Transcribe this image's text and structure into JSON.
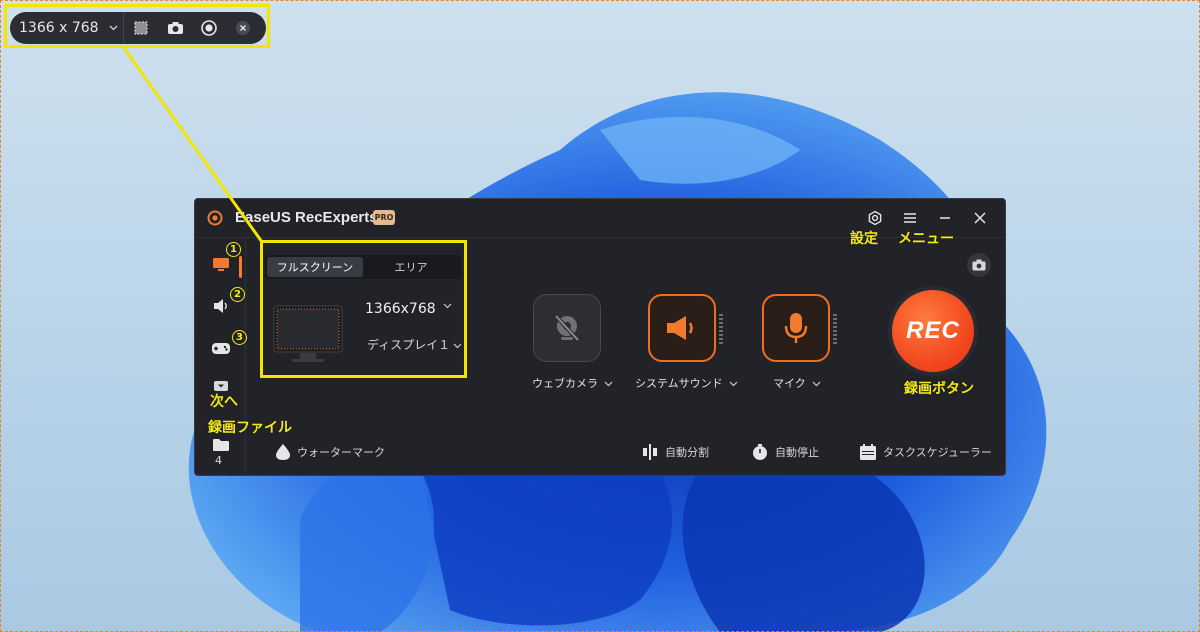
{
  "mini_toolbar": {
    "resolution": "1366 x 768",
    "icons": [
      "chevron-down-icon",
      "region-select-icon",
      "camera-icon",
      "record-icon",
      "close-icon"
    ]
  },
  "window": {
    "title": "EaseUS RecExperts",
    "badge": "PRO",
    "title_buttons": [
      "gear-icon",
      "menu-icon",
      "minimize-icon",
      "close-icon"
    ]
  },
  "sidebar": {
    "items": [
      "monitor-icon",
      "speaker-icon",
      "gamepad-icon",
      "chevron-down-icon",
      "folder-icon"
    ],
    "file_count": "4"
  },
  "capture": {
    "tabs": [
      "フルスクリーン",
      "エリア"
    ],
    "active_tab": 0,
    "resolution": "1366x768",
    "display": "ディスプレイ１"
  },
  "devices": {
    "webcam": "ウェブカメラ",
    "system_sound": "システムサウンド",
    "mic": "マイク"
  },
  "rec": {
    "label": "REC"
  },
  "bottom": {
    "watermark": "ウォーターマーク",
    "auto_split": "自動分割",
    "auto_stop": "自動停止",
    "scheduler": "タスクスケジューラー"
  },
  "annotations": {
    "settings": "設定",
    "menu": "メニュー",
    "rec_button": "録画ボタン",
    "next": "次へ",
    "recorded_files": "録画ファイル",
    "num1": "1",
    "num2": "2",
    "num3": "3"
  },
  "colors": {
    "accent": "#f06c21",
    "highlight": "#f2e600",
    "window_bg": "#222329"
  }
}
